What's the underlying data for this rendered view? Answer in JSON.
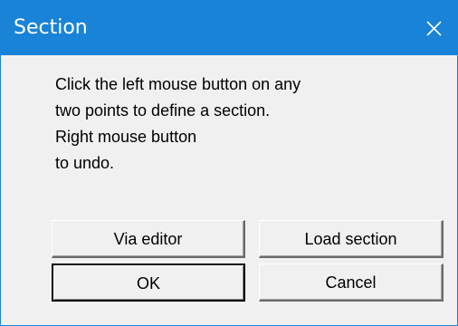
{
  "window": {
    "title": "Section",
    "close_icon": "close-icon"
  },
  "message": {
    "lines": [
      "Click the left mouse button on any",
      "two points to define a section.",
      "Right mouse button",
      "to undo."
    ]
  },
  "buttons": {
    "via_editor": "Via editor",
    "load_section": "Load section",
    "ok": "OK",
    "cancel": "Cancel"
  },
  "colors": {
    "titlebar": "#1883d7",
    "dialog_background": "#f0f0f0"
  }
}
